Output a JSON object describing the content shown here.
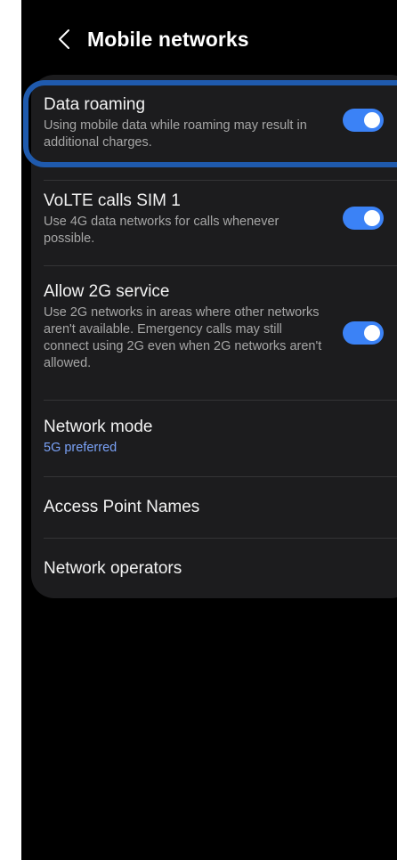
{
  "header": {
    "title": "Mobile networks",
    "back_icon": "chevron-left-icon"
  },
  "colors": {
    "background": "#000000",
    "card": "#1c1c1e",
    "accent": "#3b82f6",
    "link": "#7aa2f7",
    "focus_ring": "#1f5aad"
  },
  "settings": {
    "data_roaming": {
      "title": "Data roaming",
      "subtitle": "Using mobile data while roaming may result in additional charges.",
      "enabled": true
    },
    "volte": {
      "title": "VoLTE calls SIM 1",
      "subtitle": "Use 4G data networks for calls whenever possible.",
      "enabled": true
    },
    "allow_2g": {
      "title": "Allow 2G service",
      "subtitle": "Use 2G networks in areas where other networks aren't available. Emergency calls may still connect using 2G even when 2G networks aren't allowed.",
      "enabled": true
    },
    "network_mode": {
      "title": "Network mode",
      "value": "5G preferred"
    },
    "apn": {
      "title": "Access Point Names"
    },
    "operators": {
      "title": "Network operators"
    }
  }
}
